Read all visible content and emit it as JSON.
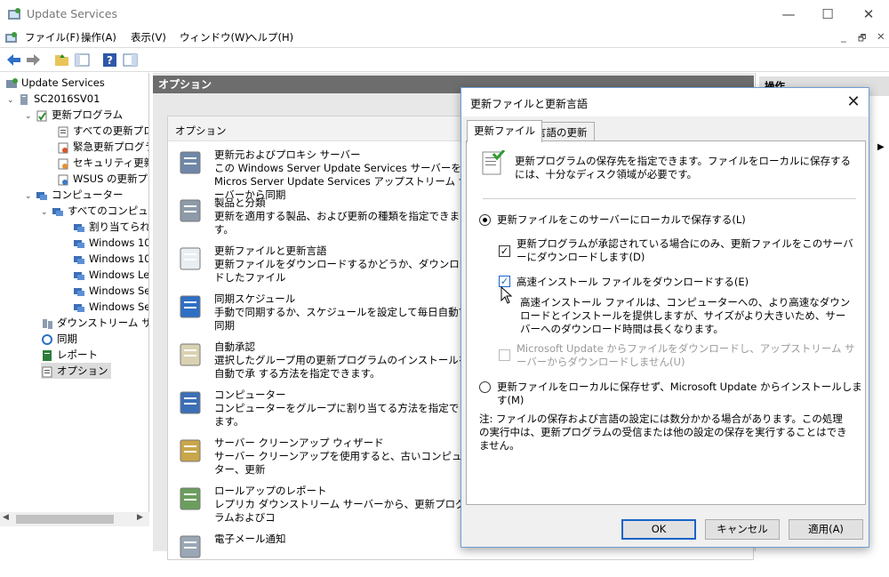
{
  "window": {
    "title": "Update Services",
    "minimize": "—",
    "maximize": "☐",
    "close": "✕"
  },
  "menu": [
    "ファイル(F)",
    "操作(A)",
    "表示(V)",
    "ウィンドウ(W)",
    "ヘルプ(H)"
  ],
  "mdi_controls": [
    "_",
    "🗗",
    "✕"
  ],
  "tree": {
    "root": "Update Services",
    "server": "SC2016SV01",
    "updates": "更新プログラム",
    "update_items": [
      "すべての更新プロ",
      "緊急更新プログラ",
      "セキュリティ更新プ",
      "WSUS の更新プロ"
    ],
    "computers": "コンピューター",
    "all_computers": "すべてのコンピュー",
    "computer_items": [
      "割り当てられ",
      "Windows 10",
      "Windows 10",
      "Windows Le",
      "Windows Se",
      "Windows Se"
    ],
    "downstream": "ダウンストリーム サーバ",
    "sync": "同期",
    "reports": "レポート",
    "options": "オプション"
  },
  "center": {
    "header": "オプション",
    "panel_title": "オプション",
    "options": [
      {
        "title": "更新元およびプロキシ サーバー",
        "desc": "この Windows Server Update Services サーバーを Micros Server Update Services アップストリーム サーバーから同期",
        "icon": "server-icon"
      },
      {
        "title": "製品と分類",
        "desc": "更新を適用する製品、および更新の種類を指定できます。",
        "icon": "products-icon"
      },
      {
        "title": "更新ファイルと更新言語",
        "desc": "更新ファイルをダウンロードするかどうか、ダウンロードしたファイル",
        "icon": "document-icon"
      },
      {
        "title": "同期スケジュール",
        "desc": "手動で同期するか、スケジュールを設定して毎日自動で同期",
        "icon": "sync-icon"
      },
      {
        "title": "自動承認",
        "desc": "選択したグループ用の更新プログラムのインストールを自動で承 する方法を指定できます。",
        "icon": "approval-icon"
      },
      {
        "title": "コンピューター",
        "desc": "コンピューターをグループに割り当てる方法を指定できます。",
        "icon": "computer-icon"
      },
      {
        "title": "サーバー クリーンアップ ウィザード",
        "desc": "サーバー クリーンアップを使用すると、古いコンピューター、更新",
        "icon": "cleanup-icon"
      },
      {
        "title": "ロールアップのレポート",
        "desc": "レプリカ ダウンストリーム サーバーから、更新プログラムおよびコ",
        "icon": "rollup-icon"
      },
      {
        "title": "電子メール通知",
        "desc": "",
        "icon": "email-icon"
      }
    ]
  },
  "right": {
    "header": "操作"
  },
  "dialog": {
    "title": "更新ファイルと更新言語",
    "tabs": [
      "更新ファイル",
      "言語の更新"
    ],
    "intro": "更新プログラムの保存先を指定できます。ファイルをローカルに保存するには、十分なディスク領域が必要です。",
    "radio_local": "更新ファイルをこのサーバーにローカルで保存する(L)",
    "chk_approved": "更新プログラムが承認されている場合にのみ、更新ファイルをこのサーバーにダウンロードします(D)",
    "chk_express": "高速インストール ファイルをダウンロードする(E)",
    "express_note": "高速インストール ファイルは、コンピューターへの、より高速なダウンロードとインストールを提供しますが、サイズがより大きいため、サーバーへのダウンロード時間は長くなります。",
    "chk_mu": "Microsoft Update からファイルをダウンロードし、アップストリーム サーバーからダウンロードしません(U)",
    "radio_mu": "更新ファイルをローカルに保存せず、Microsoft Update からインストールします(M)",
    "note": "注: ファイルの保存および言語の設定には数分かかる場合があります。この処理の実行中は、更新プログラムの受信または他の設定の保存を実行することはできません。",
    "ok": "OK",
    "cancel": "キャンセル",
    "apply": "適用(A)"
  }
}
